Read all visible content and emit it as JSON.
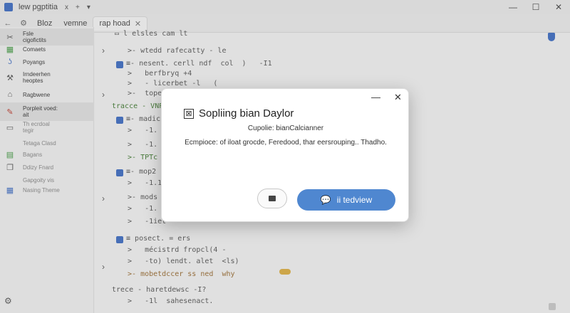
{
  "window": {
    "title": "lew pgptitia",
    "title_close": "x",
    "controls": {
      "minimize": "—",
      "maximize": "☐",
      "close": "✕"
    }
  },
  "tabs": {
    "back": "←",
    "items": [
      {
        "label": "Bloz"
      },
      {
        "label": "vemne"
      },
      {
        "label": "rap hoad",
        "close": "✕"
      }
    ]
  },
  "sidebar": {
    "items": [
      {
        "label": "Fsle",
        "sub": "cigofictits",
        "icon": "scissors-icon"
      },
      {
        "label": "Comaets",
        "icon": "grid-icon"
      },
      {
        "label": "Poyangs",
        "icon": "hook-icon"
      },
      {
        "label": "Irndeerhen",
        "sub": "heoptes",
        "icon": "wrench-icon"
      },
      {
        "label": "Ragbwene",
        "icon": "home-icon"
      },
      {
        "label": "Porpleit voed:",
        "sub": "ait",
        "icon": "pencil-icon"
      },
      {
        "label": "Th ecrdoal",
        "sub": "tegir",
        "icon": "folder-icon"
      },
      {
        "label": "Tetaga Clasd",
        "icon": ""
      },
      {
        "label": "Bagans",
        "icon": "doc-icon"
      },
      {
        "label": "Ddizy Fnard",
        "icon": "copy-icon"
      },
      {
        "label": "Gapgoity vis",
        "icon": ""
      },
      {
        "label": "Nasing Theme",
        "icon": "grid-small-icon"
      }
    ],
    "gear": "⚙"
  },
  "code": [
    {
      "text": "l elsles cam lt",
      "indent": 0
    },
    {
      "text": "wtedd rafecatty - le",
      "indent": 1
    },
    {
      "text": "nesent. cerll ndf  col  )   -I1",
      "indent": 1
    },
    {
      "text": "berfbryq +4",
      "indent": 2
    },
    {
      "text": "- licerbet -l   (",
      "indent": 2
    },
    {
      "text": "tope",
      "indent": 2
    },
    {
      "text": "tracce - VNP",
      "indent": 0
    },
    {
      "text": "madic",
      "indent": 1
    },
    {
      "text": "-1.",
      "indent": 2
    },
    {
      "text": "-1.",
      "indent": 2
    },
    {
      "text": "TPTc",
      "indent": 1
    },
    {
      "text": "mop2",
      "indent": 1
    },
    {
      "text": "-1.1         t",
      "indent": 2
    },
    {
      "text": "mods",
      "indent": 1
    },
    {
      "text": "-1.",
      "indent": 2
    },
    {
      "text": "-1iet",
      "indent": 2
    },
    {
      "text": "posect. = ers",
      "indent": 0
    },
    {
      "text": "mécistrd fropcl(4 -",
      "indent": 2
    },
    {
      "text": "-to) lendt. alet  <ls)",
      "indent": 2
    },
    {
      "text": "mobetdccer ss ned  why",
      "indent": 1
    },
    {
      "text": "trece - haretdewsc -I?",
      "indent": 0
    },
    {
      "text": "-1l  sahesenact.",
      "indent": 2
    }
  ],
  "dialog": {
    "title": "Sopliing bian Daylor",
    "subtitle": "Cupolie: bianCalcianner",
    "body": "Ecmpioce: of iloat grocde, Feredood, thar eersrouping.. Thadho.",
    "icon": "⊠",
    "minimize": "—",
    "close": "✕",
    "primary_label": "ii tedview",
    "primary_icon": "💬"
  }
}
